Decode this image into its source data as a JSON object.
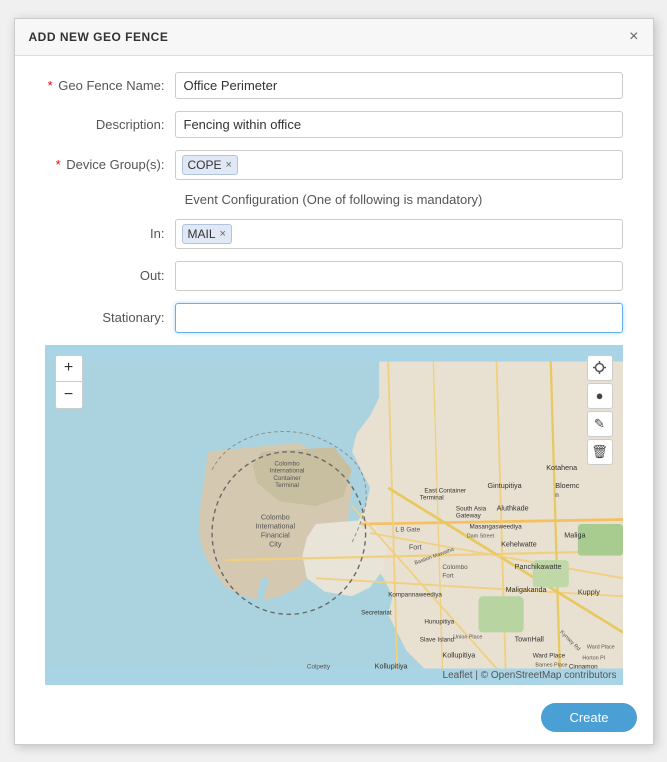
{
  "dialog": {
    "title": "ADD NEW GEO FENCE",
    "close_label": "×"
  },
  "form": {
    "geo_fence_name_label": "Geo Fence Name:",
    "geo_fence_name_required": "*",
    "geo_fence_name_value": "Office Perimeter",
    "description_label": "Description:",
    "description_value": "Fencing within office",
    "device_groups_label": "Device Group(s):",
    "device_groups_required": "*",
    "device_groups_tag": "COPE",
    "event_config_title": "Event Configuration (One of following is mandatory)",
    "in_label": "In:",
    "in_tag": "MAIL",
    "out_label": "Out:",
    "stationary_label": "Stationary:"
  },
  "map": {
    "zoom_in": "+",
    "zoom_out": "−",
    "attribution": "Leaflet | © OpenStreetMap contributors"
  },
  "footer": {
    "create_label": "Create"
  }
}
